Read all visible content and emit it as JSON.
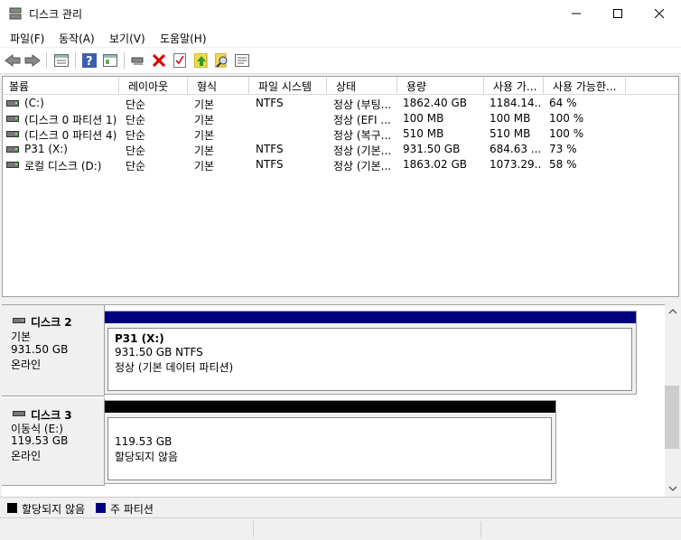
{
  "window": {
    "title": "디스크 관리"
  },
  "menu": [
    "파일(F)",
    "동작(A)",
    "보기(V)",
    "도움말(H)"
  ],
  "toolbar": {
    "icons": [
      "back-arrow-icon",
      "forward-arrow-icon",
      "disk-list-icon",
      "help-icon",
      "console-tree-icon",
      "connect-drive-icon",
      "delete-icon",
      "check-icon",
      "upload-icon",
      "search-icon",
      "properties-icon"
    ]
  },
  "volume_list": {
    "columns": [
      "볼륨",
      "레이아웃",
      "형식",
      "파일 시스템",
      "상태",
      "용량",
      "사용 가...",
      "사용 가능한..."
    ],
    "rows": [
      [
        "(C:)",
        "단순",
        "기본",
        "NTFS",
        "정상 (부팅...",
        "1862.40 GB",
        "1184.14...",
        "64 %"
      ],
      [
        "(디스크 0 파티션 1)",
        "단순",
        "기본",
        "",
        "정상 (EFI ...",
        "100 MB",
        "100 MB",
        "100 %"
      ],
      [
        "(디스크 0 파티션 4)",
        "단순",
        "기본",
        "",
        "정상 (복구...",
        "510 MB",
        "510 MB",
        "100 %"
      ],
      [
        "P31 (X:)",
        "단순",
        "기본",
        "NTFS",
        "정상 (기본...",
        "931.50 GB",
        "684.63 ...",
        "73 %"
      ],
      [
        "로컬 디스크 (D:)",
        "단순",
        "기본",
        "NTFS",
        "정상 (기본...",
        "1863.02 GB",
        "1073.29...",
        "58 %"
      ]
    ]
  },
  "disks": [
    {
      "name": "디스크 2",
      "type": "기본",
      "size": "931.50 GB",
      "status": "온라인",
      "partition": {
        "name": "P31  (X:)",
        "size": "931.50 GB NTFS",
        "status": "정상 (기본 데이터 파티션)",
        "color": "#000080"
      }
    },
    {
      "name": "디스크 3",
      "type": "이동식 (E:)",
      "size": "119.53 GB",
      "status": "온라인",
      "partition": {
        "size": "119.53 GB",
        "status": "할당되지 않음",
        "color": "#000000"
      }
    }
  ],
  "legend": [
    {
      "label": "할당되지 않음",
      "color": "#000000"
    },
    {
      "label": "주 파티션",
      "color": "#000080"
    }
  ]
}
